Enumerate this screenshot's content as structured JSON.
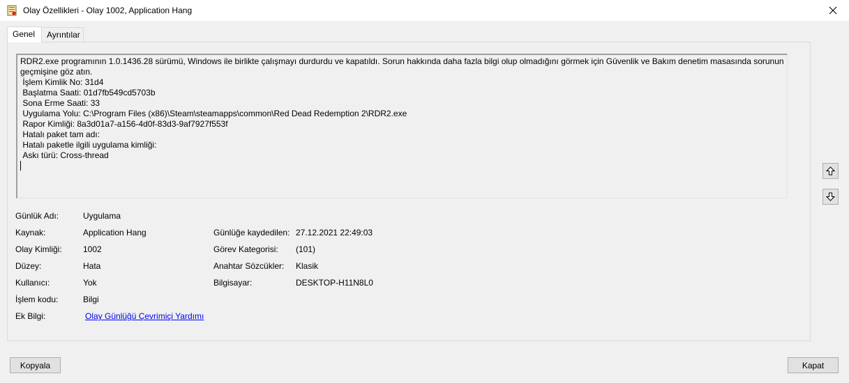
{
  "window": {
    "title": "Olay Özellikleri - Olay 1002, Application Hang",
    "close_label": "✕"
  },
  "tabs": [
    {
      "label": "Genel",
      "active": true
    },
    {
      "label": "Ayrıntılar",
      "active": false
    }
  ],
  "description": {
    "lines": [
      "RDR2.exe programının 1.0.1436.28 sürümü, Windows ile birlikte çalışmayı durdurdu ve kapatıldı. Sorun hakkında daha fazla bilgi olup olmadığını görmek için Güvenlik ve Bakım denetim masasında sorunun",
      "geçmişine göz atın.",
      " İşlem Kimlik No: 31d4",
      " Başlatma Saati: 01d7fb549cd5703b",
      " Sona Erme Saati: 33",
      " Uygulama Yolu: C:\\Program Files (x86)\\Steam\\steamapps\\common\\Red Dead Redemption 2\\RDR2.exe",
      " Rapor Kimliği: 8a3d01a7-a156-4d0f-83d3-9af7927f553f",
      " Hatalı paket tam adı: ",
      " Hatalı paketle ilgili uygulama kimliği: ",
      " Askı türü: Cross-thread"
    ]
  },
  "scroll": {
    "up_icon": "arrow-up-icon",
    "down_icon": "arrow-down-icon"
  },
  "fields": {
    "log_name_label": "Günlük Adı:",
    "log_name_value": "Uygulama",
    "source_label": "Kaynak:",
    "source_value": "Application Hang",
    "logged_label": "Günlüğe kaydedilen:",
    "logged_value": "27.12.2021 22:49:03",
    "event_id_label": "Olay Kimliği:",
    "event_id_value": "1002",
    "task_category_label": "Görev Kategorisi:",
    "task_category_value": "(101)",
    "level_label": "Düzey:",
    "level_value": "Hata",
    "keywords_label": "Anahtar Sözcükler:",
    "keywords_value": "Klasik",
    "user_label": "Kullanıcı:",
    "user_value": "Yok",
    "computer_label": "Bilgisayar:",
    "computer_value": "DESKTOP-H11N8L0",
    "opcode_label": "İşlem kodu:",
    "opcode_value": "Bilgi",
    "more_info_label": "Ek Bilgi:",
    "more_info_link": "Olay Günlüğü Çevrimiçi Yardımı"
  },
  "buttons": {
    "copy": "Kopyala",
    "close": "Kapat"
  },
  "colors": {
    "link": "#0000ee",
    "window_bg": "#f0f0f0",
    "titlebar_bg": "#ffffff"
  }
}
